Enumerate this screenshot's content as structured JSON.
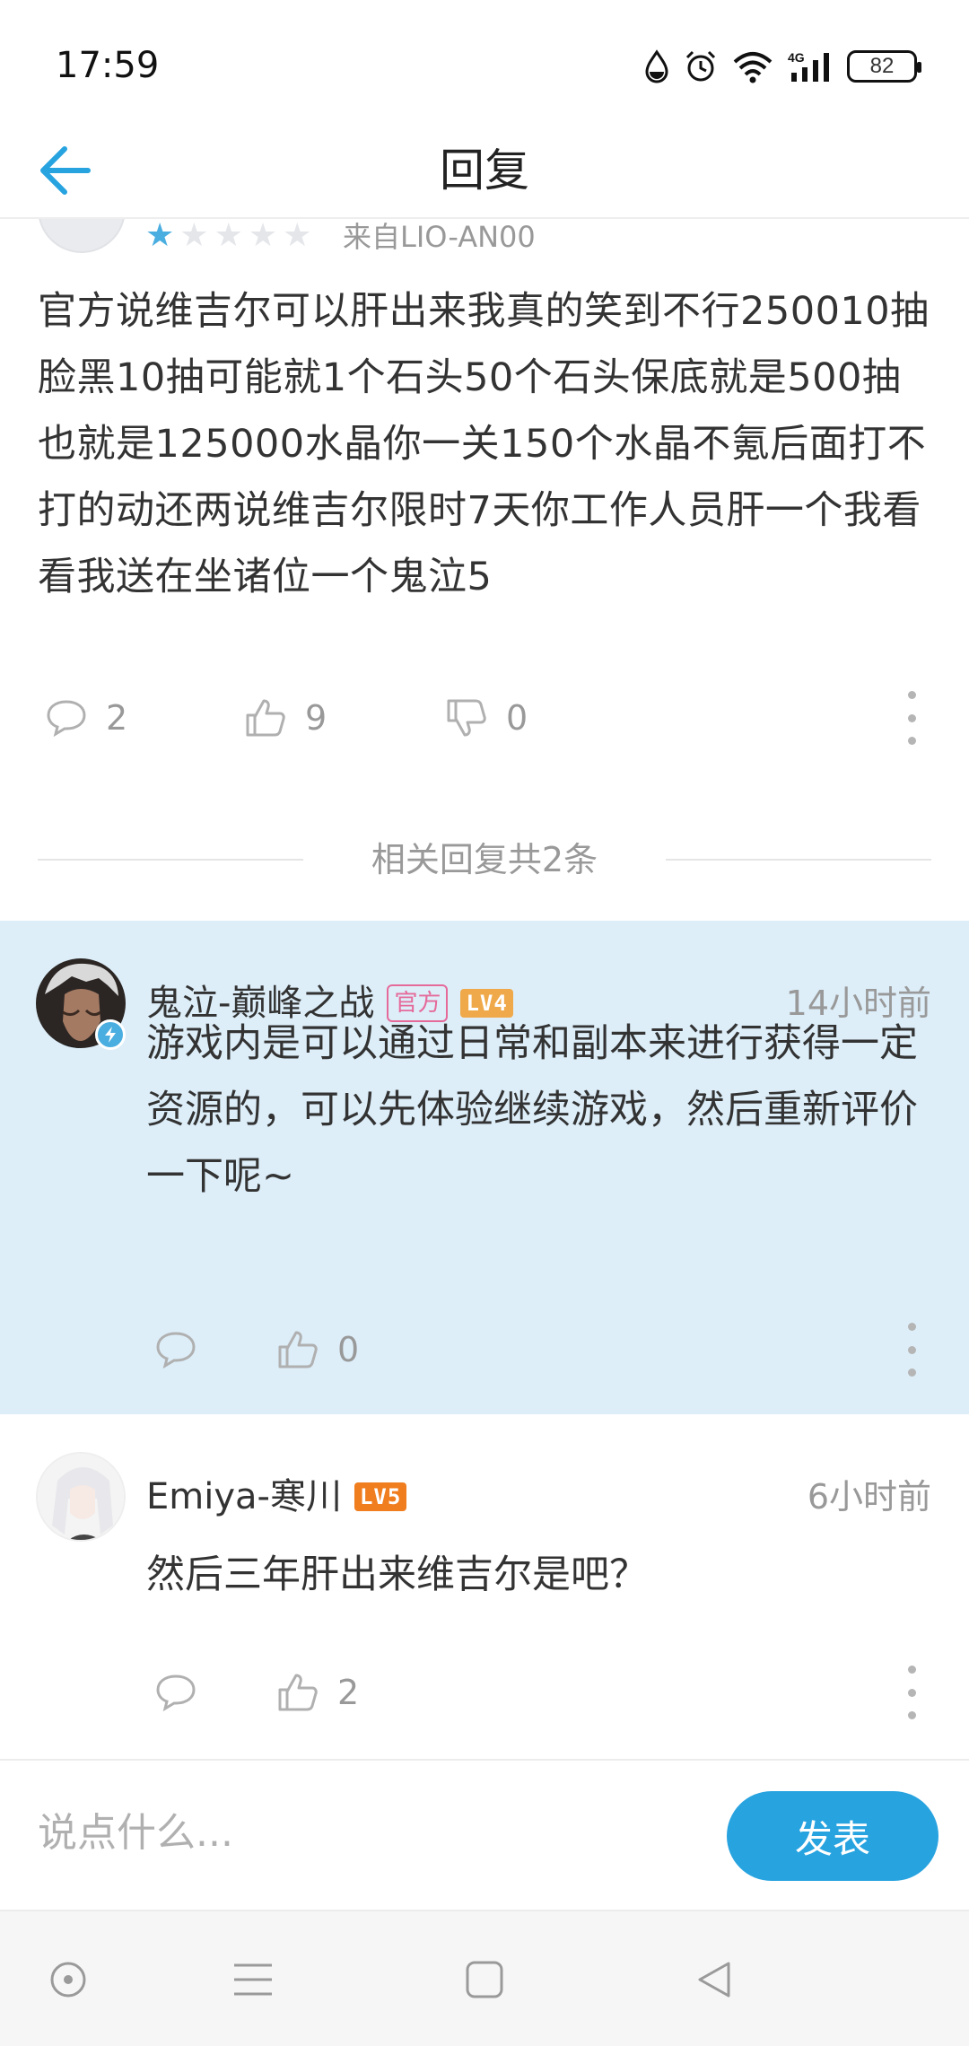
{
  "status_bar": {
    "time": "17:59",
    "network": "4G",
    "battery": "82",
    "icons": [
      "water-drop-icon",
      "alarm-icon",
      "wifi-icon",
      "signal-icon",
      "battery-icon"
    ]
  },
  "header": {
    "title": "回复",
    "back_icon": "arrow-left-icon"
  },
  "post": {
    "rating": 1,
    "rating_max": 5,
    "device": "来自LIO-AN00",
    "body": "官方说维吉尔可以肝出来我真的笑到不行250010抽脸黑10抽可能就1个石头50个石头保底就是500抽也就是125000水晶你一关150个水晶不氪后面打不打的动还两说维吉尔限时7天你工作人员肝一个我看看我送在坐诸位一个鬼泣5",
    "comments": "2",
    "likes": "9",
    "dislikes": "0"
  },
  "related": {
    "label": "相关回复共2条"
  },
  "replies": [
    {
      "name": "鬼泣-巅峰之战",
      "official_tag": "官方",
      "level": "LV4",
      "time": "14小时前",
      "text": "游戏内是可以通过日常和副本来进行获得一定资源的，可以先体验继续游戏，然后重新评价一下呢~",
      "likes": "0"
    },
    {
      "name": "Emiya-寒川",
      "level": "LV5",
      "time": "6小时前",
      "text": "然后三年肝出来维吉尔是吧？",
      "likes": "2"
    }
  ],
  "composer": {
    "placeholder": "说点什么...",
    "submit_label": "发表"
  },
  "colors": {
    "accent": "#27a3e0",
    "highlight_bg": "#ddeef9",
    "official_tag": "#e56a9a",
    "level4": "#f0a94a",
    "level5": "#f07d1e"
  },
  "nav_bar": [
    "home-circle-icon",
    "menu-icon",
    "square-icon",
    "back-triangle-icon"
  ]
}
